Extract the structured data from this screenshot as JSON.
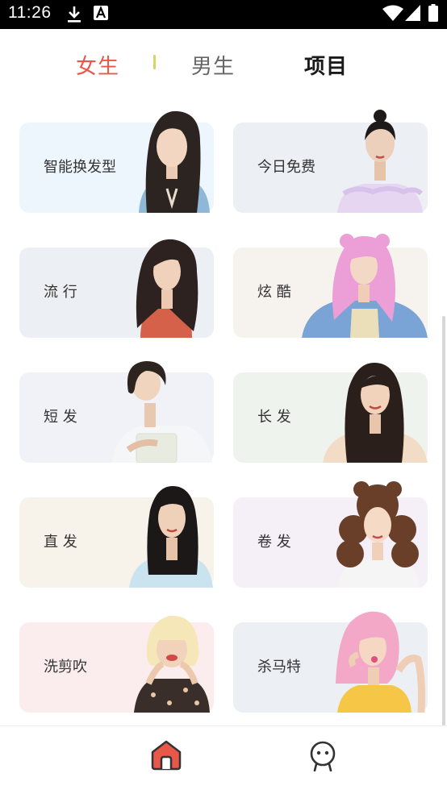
{
  "status_bar": {
    "time": "11:26",
    "icons": [
      "download-icon",
      "notification-a-icon",
      "wifi-icon",
      "cellular-signal-icon",
      "battery-icon"
    ]
  },
  "tabs": [
    {
      "label": "女生",
      "active": true
    },
    {
      "label": "男生",
      "active": false
    },
    {
      "label": "项目",
      "active": false
    }
  ],
  "cards": [
    {
      "label": "智能换发型",
      "bg": "#eef6fd"
    },
    {
      "label": "今日免费",
      "bg": "#eceff3"
    },
    {
      "label": "流 行",
      "bg": "#eceff3"
    },
    {
      "label": "炫 酷",
      "bg": "#f6f3ee"
    },
    {
      "label": "短 发",
      "bg": "#f1f2f7"
    },
    {
      "label": "长 发",
      "bg": "#eff3ee"
    },
    {
      "label": "直 发",
      "bg": "#f7f3ea"
    },
    {
      "label": "卷 发",
      "bg": "#f5f0f8"
    },
    {
      "label": "洗剪吹",
      "bg": "#fbeded"
    },
    {
      "label": "杀马特",
      "bg": "#eceff3"
    }
  ],
  "bottom_nav": {
    "items": [
      {
        "icon": "home-icon",
        "active": true
      },
      {
        "icon": "profile-face-icon",
        "active": false
      }
    ]
  },
  "colors": {
    "accent": "#e8584a",
    "tab_inactive": "#666666",
    "tab_bold": "#1a1a1a",
    "divider": "#d9d36a"
  }
}
